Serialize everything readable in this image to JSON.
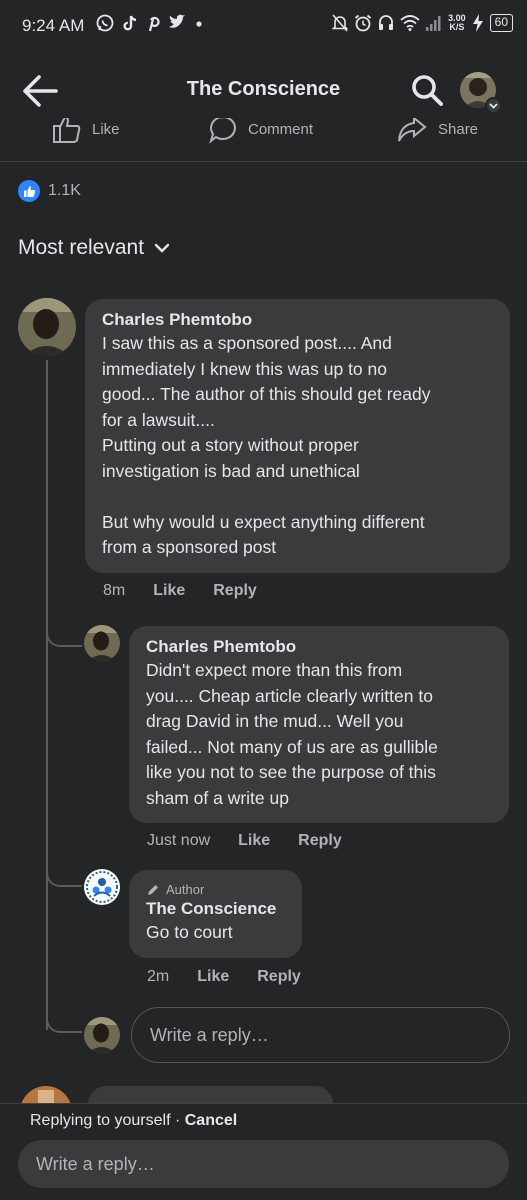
{
  "status_bar": {
    "time": "9:24 AM",
    "net_speed_value": "3.00",
    "net_speed_unit": "K/S",
    "battery": "60",
    "app_icons": [
      "whatsapp-icon",
      "tiktok-icon",
      "pinterest-icon",
      "twitter-icon",
      "dot-icon"
    ],
    "system_icons": [
      "mute-icon",
      "alarm-icon",
      "headset-icon",
      "wifi-icon",
      "signal-icon",
      "charging-icon"
    ]
  },
  "header": {
    "title": "The Conscience"
  },
  "post_actions": {
    "like": "Like",
    "comment": "Comment",
    "share": "Share"
  },
  "reactions": {
    "count": "1.1K"
  },
  "sort": {
    "label": "Most relevant"
  },
  "comments": [
    {
      "author": "Charles Phemtobo",
      "lines": [
        "I saw this as a sponsored post.... And",
        "immediately I knew this was up to no",
        "good... The author of this should get ready",
        "for a lawsuit....",
        "Putting out a story without proper",
        "investigation is bad and unethical",
        "",
        "But why would u expect anything different",
        "from a sponsored post"
      ],
      "time": "8m",
      "like": "Like",
      "reply": "Reply"
    }
  ],
  "replies": [
    {
      "author": "Charles Phemtobo",
      "lines": [
        "Didn't expect more than this from",
        "you.... Cheap article clearly written to",
        "drag David in the mud... Well you",
        "failed... Not many of us are as gullible",
        "like you not to see the purpose of this",
        "sham of a write up"
      ],
      "time": "Just now",
      "like": "Like",
      "reply": "Reply"
    },
    {
      "badge": "Author",
      "author": "The Conscience",
      "lines": [
        "Go to court"
      ],
      "time": "2m",
      "like": "Like",
      "reply": "Reply"
    }
  ],
  "thread_reply_input": {
    "placeholder": "Write a reply…"
  },
  "bottom_bar": {
    "replying_to": "Replying to yourself",
    "separator": "·",
    "cancel": "Cancel",
    "placeholder": "Write a reply…"
  },
  "colors": {
    "background": "#242526",
    "bubble": "#3a3b3c",
    "text_primary": "#e4e6eb",
    "text_secondary": "#b0b3b8",
    "like_blue": "#2d86ff"
  }
}
